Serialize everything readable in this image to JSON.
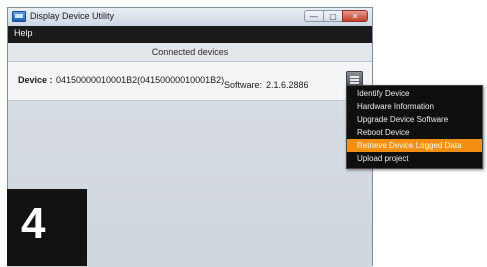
{
  "window": {
    "title": "Display Device Utility",
    "controls": {
      "minimize": "—",
      "maximize": "▢",
      "close": "✕"
    }
  },
  "menubar": {
    "help": "Help"
  },
  "panel": {
    "header": "Connected devices"
  },
  "device": {
    "label": "Device :",
    "id": "04150000010001B2(04150000010001B2)",
    "software_label": "Software:",
    "software_version": "2.1.6.2886"
  },
  "context_menu": {
    "items": [
      "Identify Device",
      "Hardware Information",
      "Upgrade Device Software",
      "Reboot Device",
      "Retrieve Device Logged Data",
      "Upload project"
    ],
    "selected": "Retrieve Device Logged Data"
  },
  "overlay": {
    "number": "4"
  },
  "colors": {
    "menu_highlight": "#f28f12",
    "menu_bg": "#0f0f0f",
    "menubar_bg": "#1a1a1a"
  }
}
